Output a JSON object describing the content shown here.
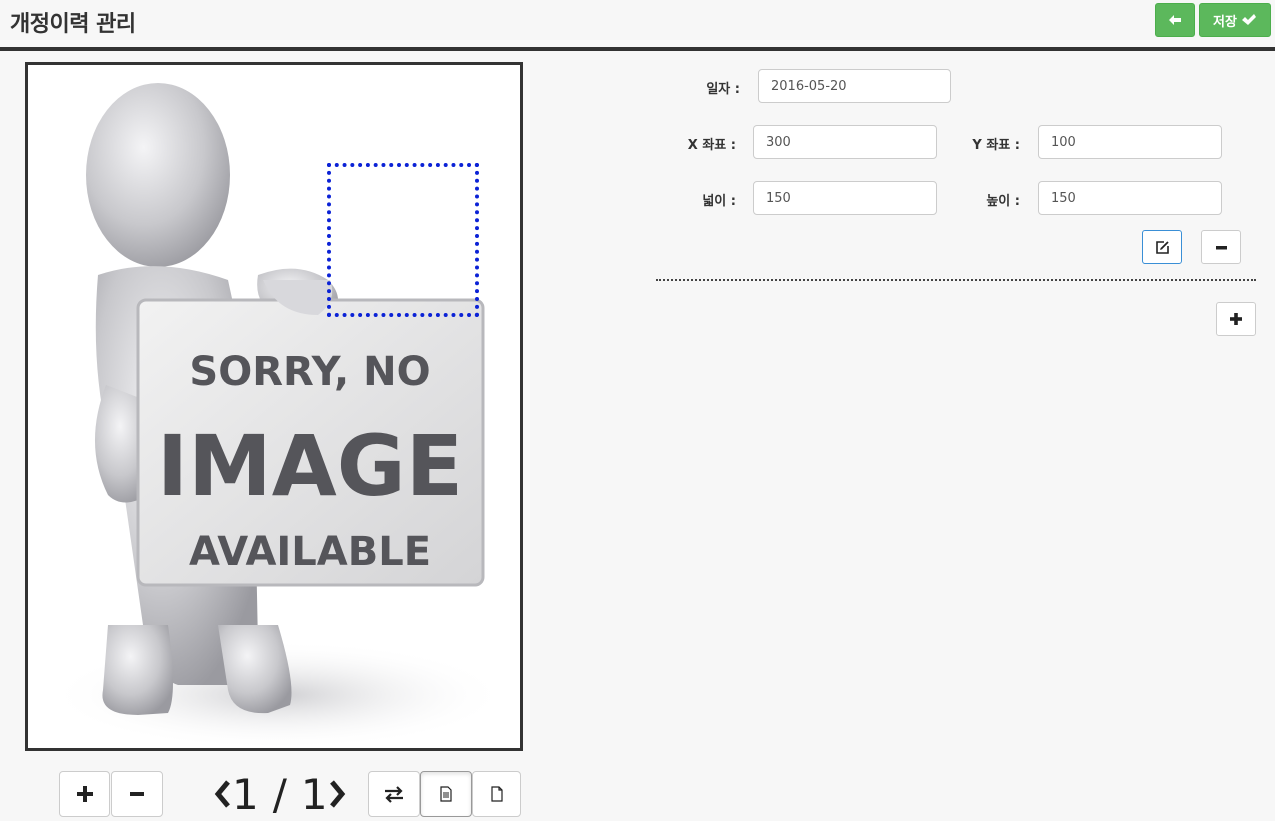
{
  "header": {
    "title": "개정이력 관리",
    "save_label": "저장"
  },
  "viewer": {
    "placeholder_text": [
      "SORRY, NO",
      "IMAGE",
      "AVAILABLE"
    ],
    "page_current": "1",
    "page_separator": "/",
    "page_total": "1"
  },
  "form": {
    "date_label": "일자 :",
    "date_value": "2016-05-20",
    "x_label": "X 좌표 :",
    "x_value": "300",
    "y_label": "Y 좌표 :",
    "y_value": "100",
    "width_label": "넓이 :",
    "width_value": "150",
    "height_label": "높이 :",
    "height_value": "150"
  },
  "colors": {
    "accent_green": "#5cb85c",
    "selection_blue": "#0b22d6",
    "edit_button_border": "#3a8fd6"
  },
  "icons": [
    "arrow-left-icon",
    "check-icon",
    "plus-icon",
    "minus-icon",
    "swap-icon",
    "document-lines-icon",
    "document-blank-icon",
    "edit-icon"
  ]
}
